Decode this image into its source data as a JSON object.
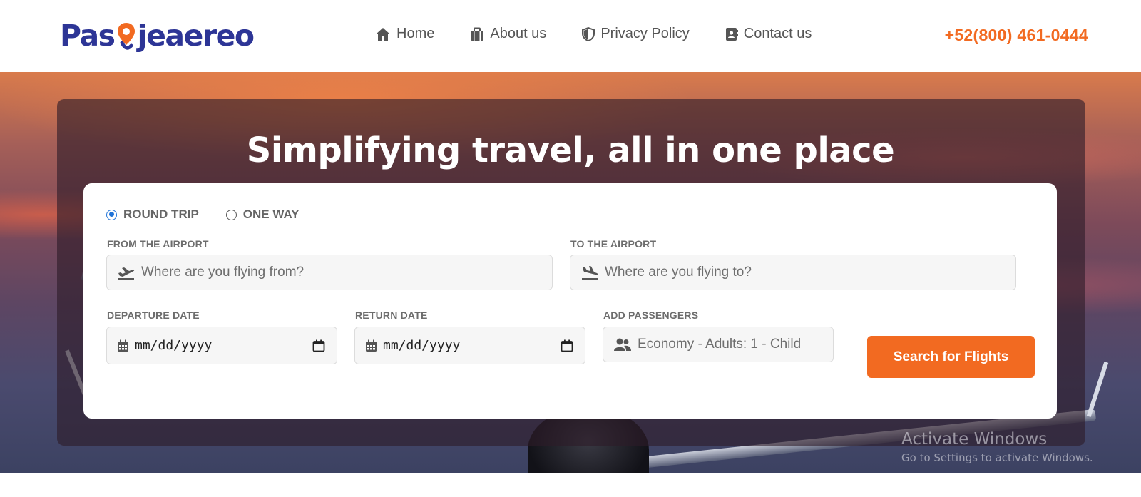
{
  "header": {
    "logo_text_left": "Pas",
    "logo_text_right": "jeaereo",
    "nav": [
      {
        "label": "Home",
        "icon": "home-icon"
      },
      {
        "label": "About us",
        "icon": "briefcase-icon"
      },
      {
        "label": "Privacy Policy",
        "icon": "shield-icon"
      },
      {
        "label": "Contact us",
        "icon": "contact-book-icon"
      }
    ],
    "phone": "+52(800) 461-0444"
  },
  "hero": {
    "title": "Simplifying travel, all in one place"
  },
  "search": {
    "trip_types": [
      {
        "label": "ROUND TRIP",
        "checked": true
      },
      {
        "label": "ONE WAY",
        "checked": false
      }
    ],
    "from": {
      "label": "FROM THE AIRPORT",
      "placeholder": "Where are you flying from?",
      "icon": "plane-departure-icon"
    },
    "to": {
      "label": "TO THE AIRPORT",
      "placeholder": "Where are you flying to?",
      "icon": "plane-arrival-icon"
    },
    "departure": {
      "label": "DEPARTURE DATE",
      "value": "mm/dd/yyyy",
      "icon": "calendar-icon"
    },
    "return": {
      "label": "RETURN DATE",
      "value": "mm/dd/yyyy",
      "icon": "calendar-icon"
    },
    "passengers": {
      "label": "ADD PASSENGERS",
      "value": "Economy - Adults: 1 - Child",
      "icon": "users-icon"
    },
    "button": "Search for Flights"
  },
  "watermark": {
    "line1": "Activate Windows",
    "line2": "Go to Settings to activate Windows."
  },
  "colors": {
    "brand_blue": "#2d3596",
    "accent_orange": "#f26a21",
    "radio_blue": "#1f73d8"
  }
}
